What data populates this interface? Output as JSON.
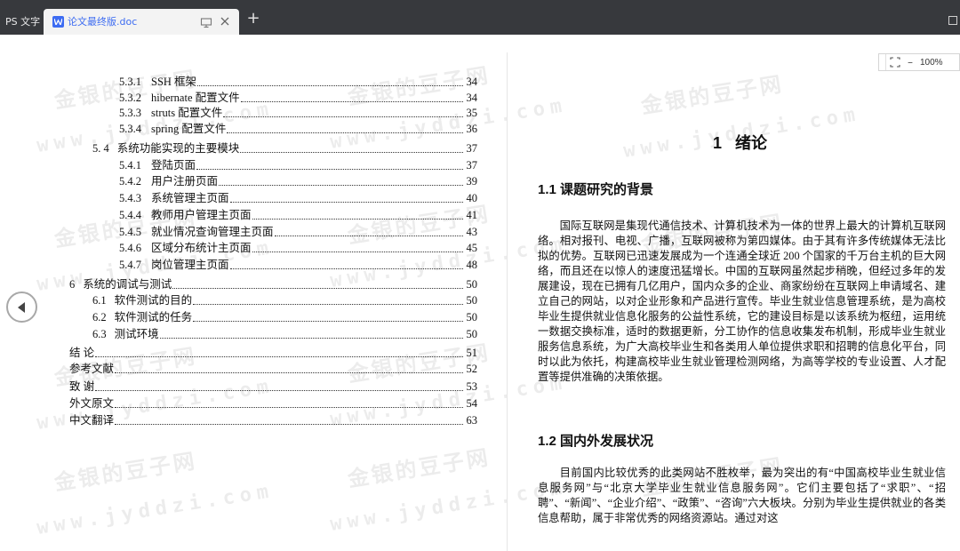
{
  "tabs": {
    "app_tab": "PS 文字",
    "doc_tab": "论文最终版.doc",
    "new_tab": "+"
  },
  "toc": [
    {
      "num": "5.3.1",
      "title": "SSH 框架",
      "page": "34"
    },
    {
      "num": "5.3.2",
      "title": "hibernate 配置文件",
      "page": "34"
    },
    {
      "num": "5.3.3",
      "title": "struts 配置文件",
      "page": "35"
    },
    {
      "num": "5.3.4",
      "title": "spring 配置文件",
      "page": "36"
    },
    {
      "num": "5. 4",
      "title": "系统功能实现的主要模块",
      "page": "37"
    },
    {
      "num": "5.4.1",
      "title": "登陆页面",
      "page": "37"
    },
    {
      "num": "5.4.2",
      "title": "用户注册页面",
      "page": "39"
    },
    {
      "num": "5.4.3",
      "title": "系统管理主页面",
      "page": "40"
    },
    {
      "num": "5.4.4",
      "title": "教师用户管理主页面",
      "page": "41"
    },
    {
      "num": "5.4.5",
      "title": "就业情况查询管理主页面",
      "page": "43"
    },
    {
      "num": "5.4.6",
      "title": "区域分布统计主页面",
      "page": "45"
    },
    {
      "num": "5.4.7",
      "title": "岗位管理主页面",
      "page": "48"
    },
    {
      "num": "6",
      "title": "系统的调试与测试",
      "page": "50"
    },
    {
      "num": "6.1",
      "title": "软件测试的目的",
      "page": "50"
    },
    {
      "num": "6.2",
      "title": "软件测试的任务",
      "page": "50"
    },
    {
      "num": "6.3",
      "title": "测试环境",
      "page": "50"
    },
    {
      "num": "",
      "title": "结 论",
      "page": "51"
    },
    {
      "num": "",
      "title": "参考文献",
      "page": "52"
    },
    {
      "num": "",
      "title": "致 谢",
      "page": "53"
    },
    {
      "num": "",
      "title": "外文原文",
      "page": "54"
    },
    {
      "num": "",
      "title": "中文翻译",
      "page": "63"
    }
  ],
  "zoom": {
    "value": "100%",
    "minus": "–"
  },
  "doc": {
    "chapter_title": "1  绪论",
    "sec1_title": "1.1   课题研究的背景",
    "sec1_body": "国际互联网是集现代通信技术、计算机技术为一体的世界上最大的计算机互联网络。相对报刊、电视、广播，互联网被称为第四媒体。由于其有许多传统媒体无法比拟的优势。互联网已迅速发展成为一个连通全球近 200 个国家的千万台主机的巨大网络，而且还在以惊人的速度迅猛增长。中国的互联网虽然起步稍晚，但经过多年的发展建设，现在已拥有几亿用户，国内众多的企业、商家纷纷在互联网上申请域名、建立自己的网站，以对企业形象和产品进行宣传。毕业生就业信息管理系统，是为高校毕业生提供就业信息化服务的公益性系统，它的建设目标是以该系统为枢纽，运用统一数据交换标准，适时的数据更新，分工协作的信息收集发布机制，形成毕业生就业服务信息系统，为广大高校毕业生和各类用人单位提供求职和招聘的信息化平台，同时以此为依托，构建高校毕业生就业管理检测网络，为高等学校的专业设置、人才配置等提供准确的决策依据。",
    "sec2_title": "1.2   国内外发展状况",
    "sec2_body": "目前国内比较优秀的此类网站不胜枚举，最为突出的有“中国高校毕业生就业信息服务网”与“北京大学毕业生就业信息服务网”。它们主要包括了“求职”、“招聘”、“新闻”、“企业介绍”、“政策”、“咨询”六大板块。分别为毕业生提供就业的各类信息帮助，属于非常优秀的网络资源站。通过对这"
  },
  "watermark": {
    "cn": "金银的豆子网",
    "url": "www.jyddzi.com"
  },
  "colors": {
    "tabbar": "#37393d",
    "accent": "#3d6cf2",
    "page": "#ffffff"
  }
}
